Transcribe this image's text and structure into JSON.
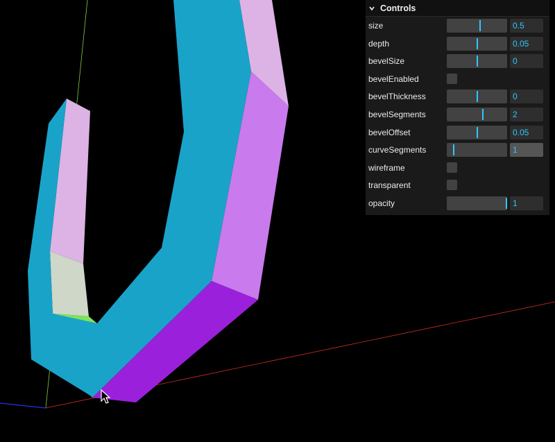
{
  "gui": {
    "title": "Controls",
    "controls": [
      {
        "label": "size",
        "type": "slider",
        "value": "0.5",
        "fraction": 0.55
      },
      {
        "label": "depth",
        "type": "slider",
        "value": "0.05",
        "fraction": 0.5
      },
      {
        "label": "bevelSize",
        "type": "slider",
        "value": "0",
        "fraction": 0.5
      },
      {
        "label": "bevelEnabled",
        "type": "checkbox",
        "checked": false
      },
      {
        "label": "bevelThickness",
        "type": "slider",
        "value": "0",
        "fraction": 0.5
      },
      {
        "label": "bevelSegments",
        "type": "slider",
        "value": "2",
        "fraction": 0.6
      },
      {
        "label": "bevelOffset",
        "type": "slider",
        "value": "0.05",
        "fraction": 0.5
      },
      {
        "label": "curveSegments",
        "type": "slider",
        "value": "1",
        "fraction": 0.1
      },
      {
        "label": "wireframe",
        "type": "checkbox",
        "checked": false
      },
      {
        "label": "transparent",
        "type": "checkbox",
        "checked": false
      },
      {
        "label": "opacity",
        "type": "slider",
        "value": "1",
        "fraction": 1.0
      }
    ]
  },
  "colors": {
    "face_front": "#1aa3c9",
    "face_side_light": "#c97aed",
    "face_side_dark": "#9b20db",
    "face_top_pale": "#dcb3e4",
    "face_inner_grey": "#cfd7c9",
    "face_inner_green": "#7de35a",
    "axis_x": "#d03020",
    "axis_y": "#88cc44",
    "axis_z": "#2233ee",
    "slider_accent": "#2cc9ff"
  }
}
